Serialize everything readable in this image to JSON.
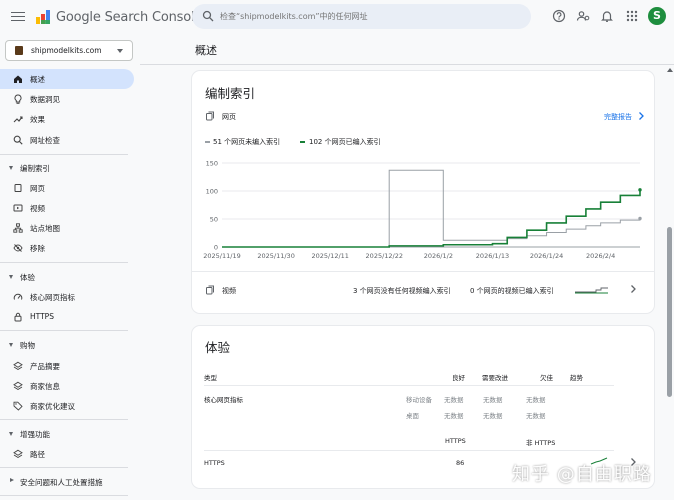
{
  "app": {
    "title": "Google Search Console"
  },
  "search": {
    "placeholder": "检查“shipmodelkits.com”中的任何网址"
  },
  "user": {
    "avatar_letter": "S"
  },
  "property": {
    "name": "shipmodelkits.com"
  },
  "sidebar": {
    "top_items": [
      {
        "label": "概述",
        "icon": "home-icon"
      },
      {
        "label": "数据洞见",
        "icon": "insights-icon"
      },
      {
        "label": "效果",
        "icon": "trending-icon"
      },
      {
        "label": "网址检查",
        "icon": "search-icon"
      }
    ],
    "sections": [
      {
        "label": "编制索引",
        "items": [
          "网页",
          "视频",
          "站点地图",
          "移除"
        ]
      },
      {
        "label": "体验",
        "items": [
          "核心网页指标",
          "HTTPS"
        ]
      },
      {
        "label": "购物",
        "items": [
          "产品摘要",
          "商家信息",
          "商家优化建议"
        ]
      },
      {
        "label": "增强功能",
        "items": [
          "路径"
        ]
      },
      {
        "label": "安全问题和人工处置措施",
        "items": []
      }
    ]
  },
  "main": {
    "page_title": "概述"
  },
  "indexing_card": {
    "title": "编制索引",
    "pages_label": "网页",
    "full_report": "完整报告",
    "legend": {
      "not_indexed": "51 个网页未编入索引",
      "indexed": "102 个网页已编入索引"
    },
    "video_label": "视频",
    "video_stat1": "3 个网页没有任何视频编入索引",
    "video_stat2": "0 个网页的视频已编入索引"
  },
  "chart_data": {
    "type": "line",
    "x_ticks": [
      "2025/11/19",
      "2025/11/30",
      "2025/12/11",
      "2025/12/22",
      "2026/1/2",
      "2026/1/13",
      "2026/1/24",
      "2026/2/4"
    ],
    "ylim": [
      0,
      150
    ],
    "y_ticks": [
      "150",
      "100",
      "50",
      "0"
    ],
    "grid": true,
    "legend_position": "top-left",
    "series": [
      {
        "name": "51 个网页未编入索引",
        "color": "#9aa0a6",
        "x": [
          "2025/11/19",
          "2025/12/22",
          "2025/12/23",
          "2026/1/2",
          "2026/1/3",
          "2026/1/13",
          "2026/1/16",
          "2026/1/20",
          "2026/1/24",
          "2026/1/28",
          "2026/2/1",
          "2026/2/4",
          "2026/2/8",
          "2026/2/12"
        ],
        "values": [
          0,
          0,
          137,
          137,
          12,
          12,
          15,
          20,
          26,
          32,
          38,
          43,
          48,
          51
        ]
      },
      {
        "name": "102 个网页已编入索引",
        "color": "#188038",
        "x": [
          "2025/11/19",
          "2025/12/22",
          "2025/12/23",
          "2026/1/2",
          "2026/1/3",
          "2026/1/13",
          "2026/1/16",
          "2026/1/20",
          "2026/1/24",
          "2026/1/28",
          "2026/2/1",
          "2026/2/4",
          "2026/2/8",
          "2026/2/12"
        ],
        "values": [
          0,
          0,
          2,
          2,
          4,
          6,
          17,
          30,
          43,
          55,
          68,
          80,
          92,
          102
        ]
      }
    ]
  },
  "experience_card": {
    "title": "体验",
    "headers": {
      "type": "类型",
      "good": "良好",
      "needs_improvement": "需要改进",
      "poor": "欠佳",
      "trend": "趋势"
    },
    "cwv_label": "核心网页指标",
    "cwv_rows": [
      {
        "device": "移动设备",
        "good": "无数据",
        "ni": "无数据",
        "poor": "无数据"
      },
      {
        "device": "桌面",
        "good": "无数据",
        "ni": "无数据",
        "poor": "无数据"
      }
    ],
    "https_headers": {
      "https": "HTTPS",
      "non_https": "非 HTTPS"
    },
    "https_row": {
      "label": "HTTPS",
      "https": "86",
      "non_https": ""
    }
  },
  "watermark": "知乎 @自由职路"
}
